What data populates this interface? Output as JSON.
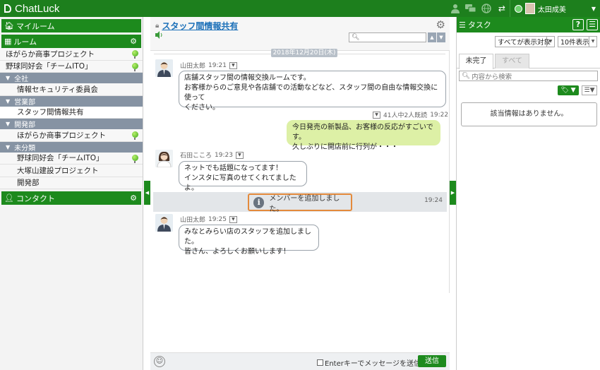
{
  "app": {
    "title": "ChatLuck"
  },
  "topbar": {
    "user_name": "太田成美"
  },
  "sidebar": {
    "myroom_label": "マイルーム",
    "room_label": "ルーム",
    "top_rooms": [
      {
        "label": "ほがらか商事プロジェクト",
        "online": true
      },
      {
        "label": "野球同好会「チームITO」",
        "online": true
      }
    ],
    "sections": [
      {
        "label": "全社",
        "items": [
          {
            "label": "情報セキュリティ委員会",
            "online": false
          }
        ]
      },
      {
        "label": "営業部",
        "items": [
          {
            "label": "スタッフ間情報共有",
            "online": false,
            "selected": true
          }
        ]
      },
      {
        "label": "開発部",
        "items": [
          {
            "label": "ほがらか商事プロジェクト",
            "online": true
          }
        ]
      },
      {
        "label": "未分類",
        "items": [
          {
            "label": "野球同好会「チームITO」",
            "online": true
          },
          {
            "label": "大塚山建設プロジェクト",
            "online": false
          },
          {
            "label": "開発部",
            "online": false
          }
        ]
      }
    ],
    "contact_label": "コンタクト"
  },
  "room": {
    "title": "スタッフ間情報共有"
  },
  "chat": {
    "date_label": "2018年12月20日(木)",
    "messages": [
      {
        "sender": "山田太郎",
        "time": "19:21",
        "text": "店舗スタッフ間の情報交換ルームです。\nお客様からのご意見や各店舗での活動などなど、スタッフ間の自由な情報交換に使って\nください。"
      },
      {
        "read_info": "41人中2人既読",
        "time": "19:22",
        "text": "今日発売の新製品、お客様の反応がすごいです。\n久しぶりに開店前に行列が・・・"
      },
      {
        "sender": "石田こころ",
        "time": "19:23",
        "text": "ネットでも話題になってます！\nインスタに写真のせてくれてましたよ。"
      },
      {
        "sender": "山田太郎",
        "time": "19:25",
        "text": "みなとみらい店のスタッフを追加しました。\n皆さん、よろしくお願いします！"
      }
    ],
    "system": {
      "text": "メンバーを追加しました。",
      "time": "19:24"
    }
  },
  "composer": {
    "enter_label": "Enterキーでメッセージを送信",
    "send_label": "送信"
  },
  "task_panel": {
    "title": "タスク",
    "filter_value": "すべてが表示対象",
    "count_value": "10件表示",
    "tabs": [
      "未完了",
      "すべて"
    ],
    "search_placeholder": "内容から検索",
    "empty_text": "該当情報はありません。"
  }
}
